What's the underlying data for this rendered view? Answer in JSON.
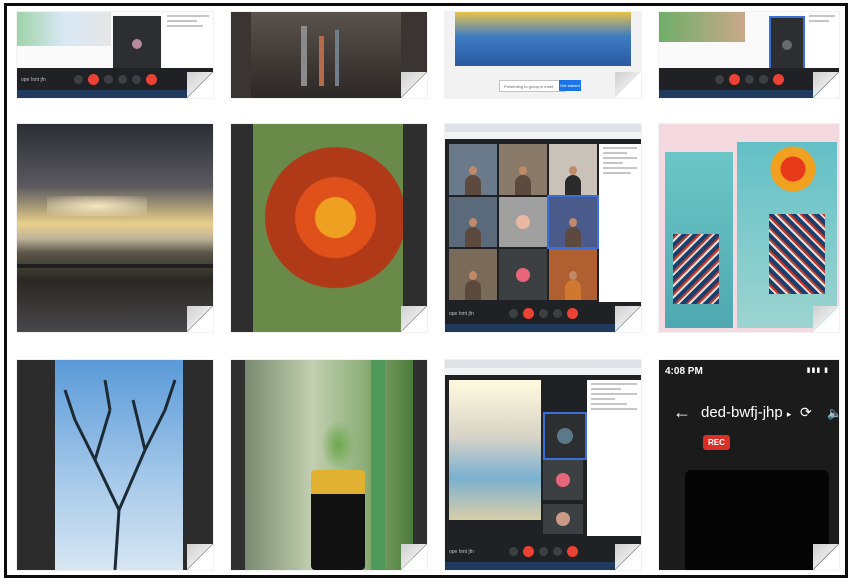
{
  "collage": {
    "row1": {
      "t1": {
        "code": "ope hmt jfn"
      },
      "t2": {},
      "t3": {
        "search_placeholder": "Presenting to group in meet",
        "button": "Get started"
      },
      "t4": {}
    },
    "row2": {
      "t7": {
        "code": "ope hmt jfn"
      }
    },
    "row3": {
      "t11": {
        "code": "ope hmt jfn"
      },
      "phone": {
        "time": "4:08 PM",
        "meeting_code": "ded-bwfj-jhp",
        "rec": "REC"
      }
    }
  },
  "colors": {
    "meet_bar": "#202124",
    "end_call": "#ea4335",
    "rec": "#d93025"
  },
  "icons": [
    "back-arrow-icon",
    "chevron-right-icon",
    "switch-camera-icon",
    "volume-icon",
    "page-curl-icon"
  ]
}
